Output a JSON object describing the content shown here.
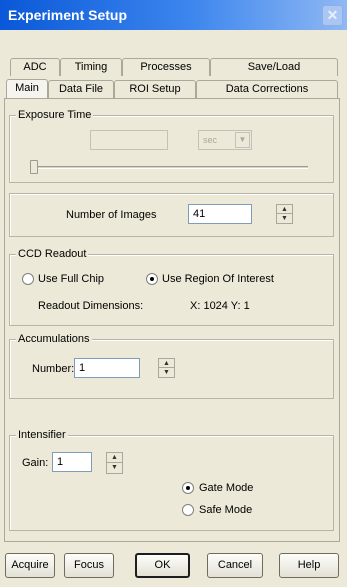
{
  "window": {
    "title": "Experiment Setup"
  },
  "tabs_top": [
    "ADC",
    "Timing",
    "Processes",
    "Save/Load"
  ],
  "tabs_bottom": [
    "Main",
    "Data File",
    "ROI Setup",
    "Data Corrections"
  ],
  "exposure": {
    "legend": "Exposure Time",
    "value": "",
    "unit": "sec"
  },
  "images": {
    "label": "Number of Images",
    "value": "41"
  },
  "ccd": {
    "legend": "CCD Readout",
    "option_full": "Use Full Chip",
    "option_roi": "Use Region Of Interest",
    "selected": "roi",
    "dims_label": "Readout Dimensions:",
    "dims_value": "X: 1024  Y: 1"
  },
  "accumulations": {
    "legend": "Accumulations",
    "label": "Number:",
    "value": "1"
  },
  "intensifier": {
    "legend": "Intensifier",
    "gain_label": "Gain:",
    "gain_value": "1",
    "option_gate": "Gate Mode",
    "option_safe": "Safe Mode",
    "selected": "gate"
  },
  "buttons": {
    "acquire": "Acquire",
    "focus": "Focus",
    "ok": "OK",
    "cancel": "Cancel",
    "help": "Help"
  },
  "icons": {
    "close": "close-icon",
    "spin_up": "up-arrow-icon",
    "spin_down": "down-arrow-icon",
    "dropdown": "chevron-down-icon"
  }
}
